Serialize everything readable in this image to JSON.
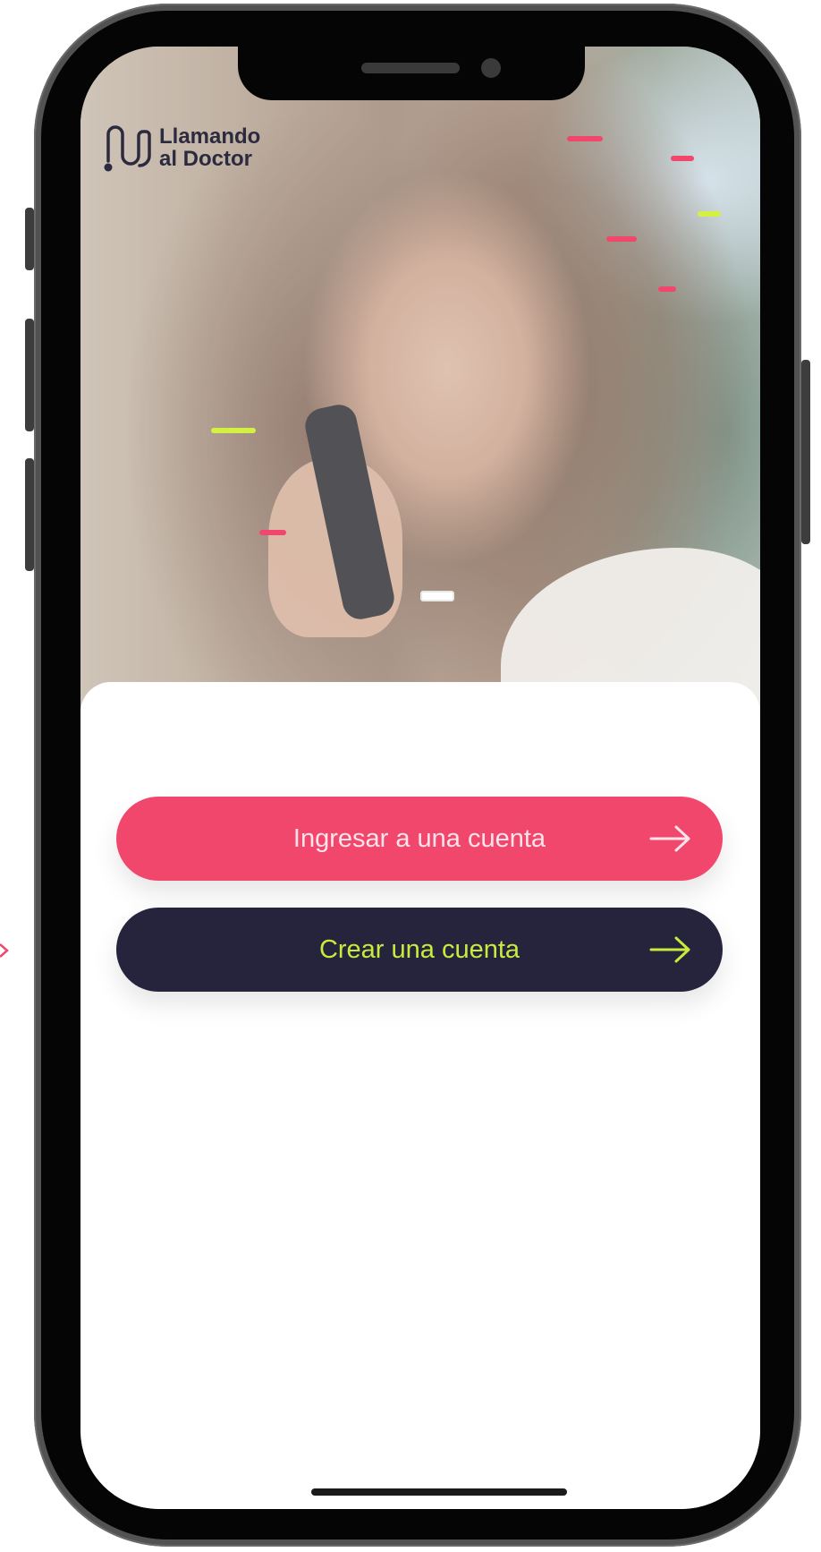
{
  "brand": {
    "name_line1": "Llamando",
    "name_line2": "al Doctor",
    "icon": "stethoscope-logo-icon"
  },
  "actions": {
    "login_label": "Ingresar a una cuenta",
    "create_label": "Crear una cuenta",
    "arrow_icon": "arrow-right-icon"
  },
  "colors": {
    "primary_pink": "#f2476c",
    "dark_navy": "#26233d",
    "lime_accent": "#c8ec3c",
    "device_frame": "#050505"
  }
}
